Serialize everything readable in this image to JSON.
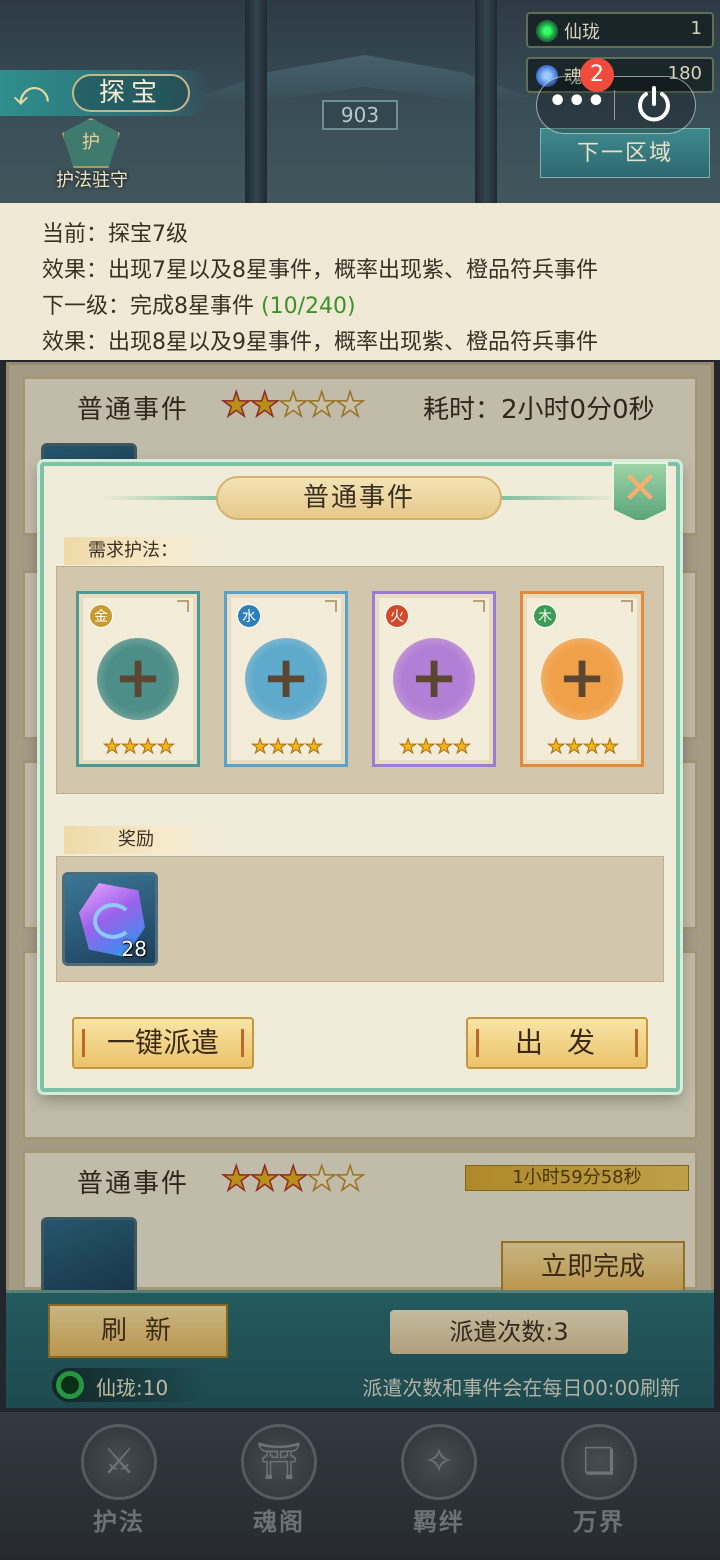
{
  "header": {
    "title": "探宝",
    "area_level": "903",
    "guard_label": "护法驻守",
    "next_zone": "下一区域",
    "resources": [
      {
        "name": "仙珑",
        "value": "1"
      },
      {
        "name": "魂",
        "value": "180"
      }
    ],
    "notification_count": "2",
    "more_glyph": "•••"
  },
  "info": {
    "current": "当前：探宝7级",
    "effect_current": "效果：出现7星以及8星事件，概率出现紫、橙品符兵事件",
    "next_label": "下一级：完成8星事件 ",
    "next_progress": "(10/240)",
    "effect_next": "效果：出现8星以及9星事件，概率出现紫、橙品符兵事件"
  },
  "events": [
    {
      "title": "普通事件",
      "stars_filled": 2,
      "stars_total": 5,
      "time_label": "耗时：2小时0分0秒"
    },
    {
      "title": "普通事件",
      "stars_filled": 3,
      "stars_total": 5,
      "timer": "1小时59分58秒",
      "action": "立即完成"
    }
  ],
  "dialog": {
    "title": "普通事件",
    "required_label": "需求护法：",
    "slots": [
      {
        "element": "金",
        "color": "#c99a2c",
        "fill": "#4d8f88",
        "stars": "★★★★"
      },
      {
        "element": "水",
        "color": "#2f7fb8",
        "fill": "#5ea9cc",
        "stars": "★★★★"
      },
      {
        "element": "火",
        "color": "#d2492c",
        "fill": "#b27fd6",
        "stars": "★★★★"
      },
      {
        "element": "木",
        "color": "#3d9b53",
        "fill": "#f1a04a",
        "stars": "★★★★"
      }
    ],
    "plus_glyph": "+",
    "reward_label": "奖励",
    "reward_count": "28",
    "auto_dispatch": "一键派遣",
    "depart": "出发",
    "close_glyph": "✕"
  },
  "bottom": {
    "refresh": "刷新",
    "dispatch_count": "派遣次数:3",
    "currency": "仙珑:10",
    "refresh_note": "派遣次数和事件会在每日00:00刷新"
  },
  "nav": [
    {
      "label": "护法",
      "icon": "sword-icon"
    },
    {
      "label": "魂阁",
      "icon": "pavilion-icon"
    },
    {
      "label": "羁绊",
      "icon": "bond-icon"
    },
    {
      "label": "万界",
      "icon": "book-icon"
    }
  ],
  "colors": {
    "accent_green": "#3f8f2a",
    "dialog_border": "#7cc2a4",
    "gold_button": "#ebc36a"
  }
}
